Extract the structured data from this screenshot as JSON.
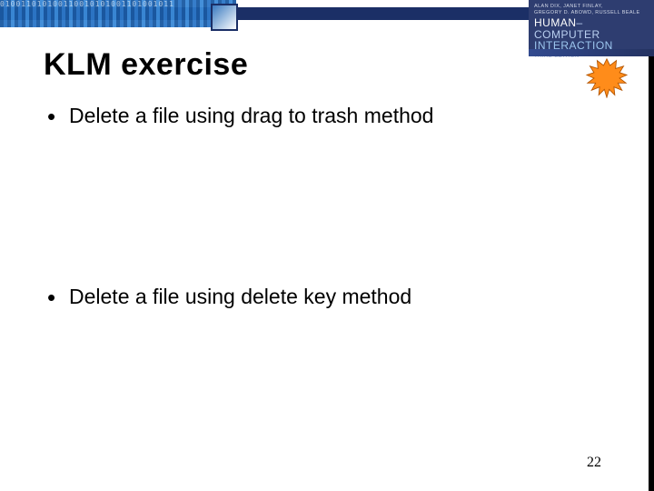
{
  "header": {
    "binary_decor": "010011010100110010101001101001011",
    "book": {
      "authors_line1": "ALAN DIX, JANET FINLAY,",
      "authors_line2": "GREGORY D. ABOWD, RUSSELL BEALE",
      "title_human": "HUMAN",
      "title_sep": "–",
      "title_computer": "COMPUTER",
      "title_interaction": "INTERACTION",
      "edition": "THIRD EDITION"
    }
  },
  "slide": {
    "title": "KLM exercise",
    "bullets": [
      "Delete a file using drag to trash method",
      "Delete a file using delete key method"
    ]
  },
  "page_number": "22"
}
